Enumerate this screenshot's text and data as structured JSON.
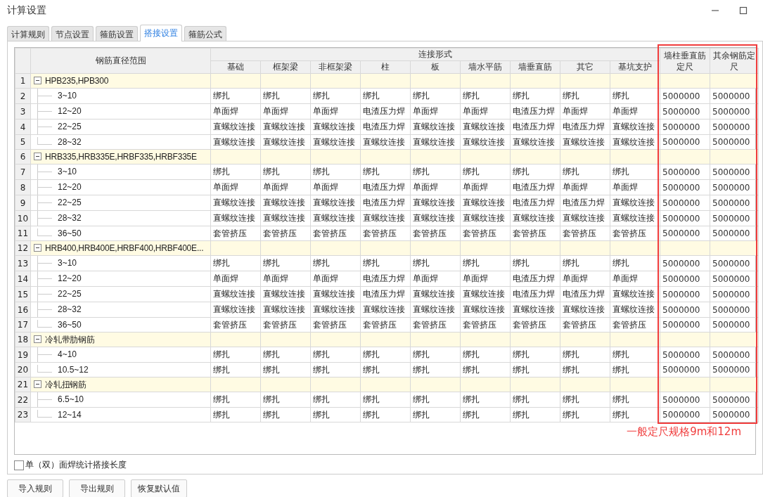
{
  "window": {
    "title": "计算设置"
  },
  "tabs": [
    {
      "label": "计算规则",
      "selected": false
    },
    {
      "label": "节点设置",
      "selected": false
    },
    {
      "label": "箍筋设置",
      "selected": false
    },
    {
      "label": "搭接设置",
      "selected": true
    },
    {
      "label": "箍筋公式",
      "selected": false
    }
  ],
  "table": {
    "name_header": "钢筋直径范围",
    "group_header": "连接形式",
    "columns": [
      "基础",
      "框架梁",
      "非框架梁",
      "柱",
      "板",
      "墙水平筋",
      "墙垂直筋",
      "其它",
      "基坑支护"
    ],
    "length_columns": [
      "墙柱垂直筋定尺",
      "其余钢筋定尺"
    ],
    "groups": [
      {
        "no": "1",
        "name": "HPB235,HPB300",
        "expanded": true,
        "children": [
          {
            "no": "2",
            "range": "3~10",
            "cells": [
              "绑扎",
              "绑扎",
              "绑扎",
              "绑扎",
              "绑扎",
              "绑扎",
              "绑扎",
              "绑扎",
              "绑扎"
            ],
            "lengths": [
              "5000000",
              "5000000"
            ]
          },
          {
            "no": "3",
            "range": "12~20",
            "cells": [
              "单面焊",
              "单面焊",
              "单面焊",
              "电渣压力焊",
              "单面焊",
              "单面焊",
              "电渣压力焊",
              "单面焊",
              "单面焊"
            ],
            "lengths": [
              "5000000",
              "5000000"
            ]
          },
          {
            "no": "4",
            "range": "22~25",
            "cells": [
              "直螺纹连接",
              "直螺纹连接",
              "直螺纹连接",
              "电渣压力焊",
              "直螺纹连接",
              "直螺纹连接",
              "电渣压力焊",
              "电渣压力焊",
              "直螺纹连接"
            ],
            "lengths": [
              "5000000",
              "5000000"
            ]
          },
          {
            "no": "5",
            "range": "28~32",
            "cells": [
              "直螺纹连接",
              "直螺纹连接",
              "直螺纹连接",
              "直螺纹连接",
              "直螺纹连接",
              "直螺纹连接",
              "直螺纹连接",
              "直螺纹连接",
              "直螺纹连接"
            ],
            "lengths": [
              "5000000",
              "5000000"
            ]
          }
        ]
      },
      {
        "no": "6",
        "name": "HRB335,HRB335E,HRBF335,HRBF335E",
        "expanded": true,
        "children": [
          {
            "no": "7",
            "range": "3~10",
            "cells": [
              "绑扎",
              "绑扎",
              "绑扎",
              "绑扎",
              "绑扎",
              "绑扎",
              "绑扎",
              "绑扎",
              "绑扎"
            ],
            "lengths": [
              "5000000",
              "5000000"
            ]
          },
          {
            "no": "8",
            "range": "12~20",
            "cells": [
              "单面焊",
              "单面焊",
              "单面焊",
              "电渣压力焊",
              "单面焊",
              "单面焊",
              "电渣压力焊",
              "单面焊",
              "单面焊"
            ],
            "lengths": [
              "5000000",
              "5000000"
            ]
          },
          {
            "no": "9",
            "range": "22~25",
            "cells": [
              "直螺纹连接",
              "直螺纹连接",
              "直螺纹连接",
              "电渣压力焊",
              "直螺纹连接",
              "直螺纹连接",
              "电渣压力焊",
              "电渣压力焊",
              "直螺纹连接"
            ],
            "lengths": [
              "5000000",
              "5000000"
            ]
          },
          {
            "no": "10",
            "range": "28~32",
            "cells": [
              "直螺纹连接",
              "直螺纹连接",
              "直螺纹连接",
              "直螺纹连接",
              "直螺纹连接",
              "直螺纹连接",
              "直螺纹连接",
              "直螺纹连接",
              "直螺纹连接"
            ],
            "lengths": [
              "5000000",
              "5000000"
            ]
          },
          {
            "no": "11",
            "range": "36~50",
            "cells": [
              "套管挤压",
              "套管挤压",
              "套管挤压",
              "套管挤压",
              "套管挤压",
              "套管挤压",
              "套管挤压",
              "套管挤压",
              "套管挤压"
            ],
            "lengths": [
              "5000000",
              "5000000"
            ]
          }
        ]
      },
      {
        "no": "12",
        "name": "HRB400,HRB400E,HRBF400,HRBF400E...",
        "expanded": true,
        "children": [
          {
            "no": "13",
            "range": "3~10",
            "cells": [
              "绑扎",
              "绑扎",
              "绑扎",
              "绑扎",
              "绑扎",
              "绑扎",
              "绑扎",
              "绑扎",
              "绑扎"
            ],
            "lengths": [
              "5000000",
              "5000000"
            ]
          },
          {
            "no": "14",
            "range": "12~20",
            "cells": [
              "单面焊",
              "单面焊",
              "单面焊",
              "电渣压力焊",
              "单面焊",
              "单面焊",
              "电渣压力焊",
              "单面焊",
              "单面焊"
            ],
            "lengths": [
              "5000000",
              "5000000"
            ]
          },
          {
            "no": "15",
            "range": "22~25",
            "cells": [
              "直螺纹连接",
              "直螺纹连接",
              "直螺纹连接",
              "电渣压力焊",
              "直螺纹连接",
              "直螺纹连接",
              "电渣压力焊",
              "电渣压力焊",
              "直螺纹连接"
            ],
            "lengths": [
              "5000000",
              "5000000"
            ]
          },
          {
            "no": "16",
            "range": "28~32",
            "cells": [
              "直螺纹连接",
              "直螺纹连接",
              "直螺纹连接",
              "直螺纹连接",
              "直螺纹连接",
              "直螺纹连接",
              "直螺纹连接",
              "直螺纹连接",
              "直螺纹连接"
            ],
            "lengths": [
              "5000000",
              "5000000"
            ]
          },
          {
            "no": "17",
            "range": "36~50",
            "cells": [
              "套管挤压",
              "套管挤压",
              "套管挤压",
              "套管挤压",
              "套管挤压",
              "套管挤压",
              "套管挤压",
              "套管挤压",
              "套管挤压"
            ],
            "lengths": [
              "5000000",
              "5000000"
            ]
          }
        ]
      },
      {
        "no": "18",
        "name": "冷轧带肋钢筋",
        "expanded": true,
        "children": [
          {
            "no": "19",
            "range": "4~10",
            "cells": [
              "绑扎",
              "绑扎",
              "绑扎",
              "绑扎",
              "绑扎",
              "绑扎",
              "绑扎",
              "绑扎",
              "绑扎"
            ],
            "lengths": [
              "5000000",
              "5000000"
            ]
          },
          {
            "no": "20",
            "range": "10.5~12",
            "cells": [
              "绑扎",
              "绑扎",
              "绑扎",
              "绑扎",
              "绑扎",
              "绑扎",
              "绑扎",
              "绑扎",
              "绑扎"
            ],
            "lengths": [
              "5000000",
              "5000000"
            ]
          }
        ]
      },
      {
        "no": "21",
        "name": "冷轧扭钢筋",
        "expanded": true,
        "children": [
          {
            "no": "22",
            "range": "6.5~10",
            "cells": [
              "绑扎",
              "绑扎",
              "绑扎",
              "绑扎",
              "绑扎",
              "绑扎",
              "绑扎",
              "绑扎",
              "绑扎"
            ],
            "lengths": [
              "5000000",
              "5000000"
            ]
          },
          {
            "no": "23",
            "range": "12~14",
            "cells": [
              "绑扎",
              "绑扎",
              "绑扎",
              "绑扎",
              "绑扎",
              "绑扎",
              "绑扎",
              "绑扎",
              "绑扎"
            ],
            "lengths": [
              "5000000",
              "5000000"
            ]
          }
        ]
      }
    ]
  },
  "annotation": "一般定尺规格9m和12m",
  "option": {
    "label": "单（双）面焊统计搭接长度",
    "checked": false
  },
  "buttons": [
    "导入规则",
    "导出规则",
    "恢复默认值"
  ]
}
